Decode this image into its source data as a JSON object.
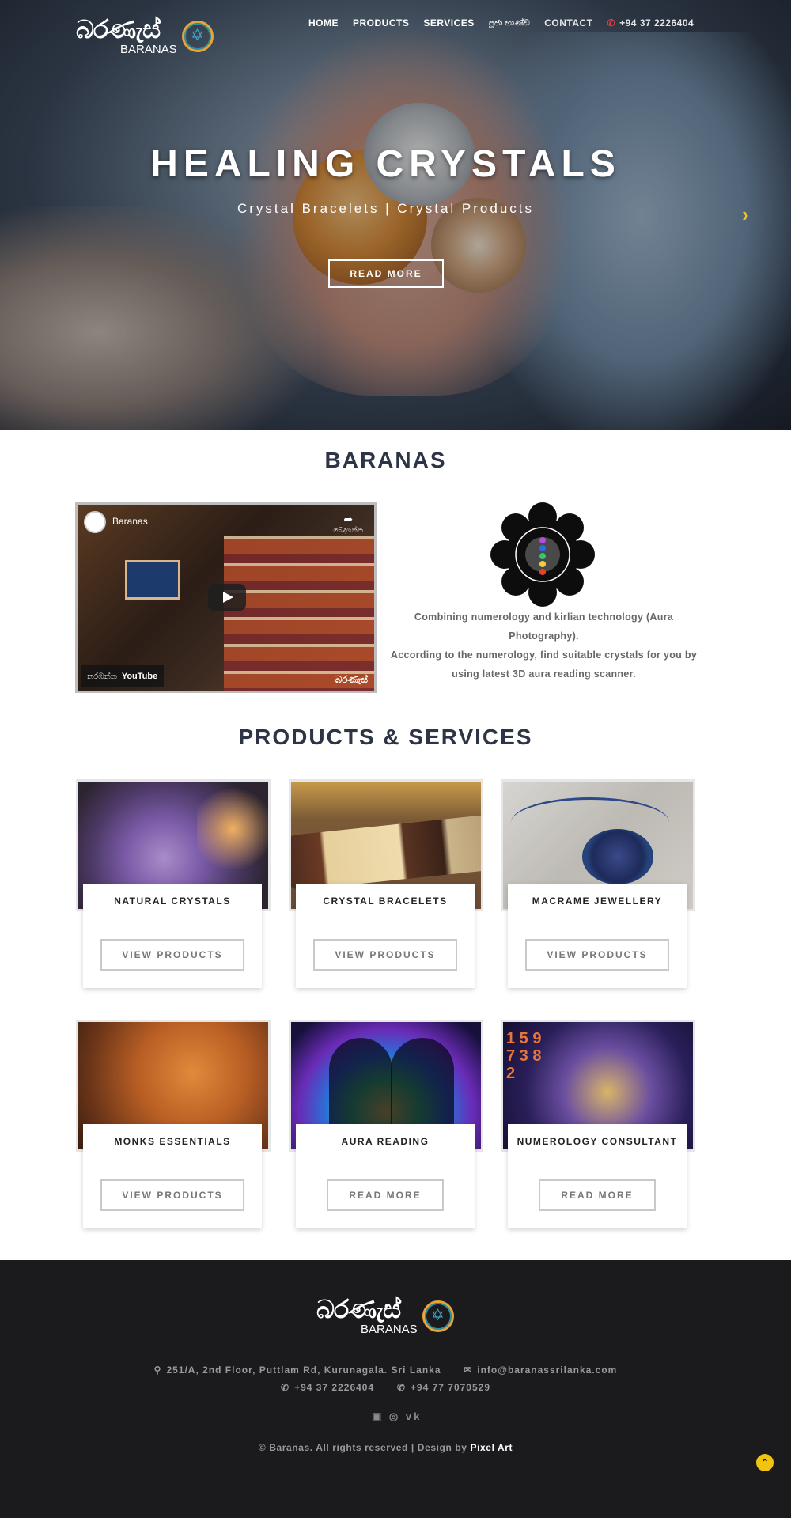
{
  "brand": {
    "script": "බරණැස්",
    "name": "BARANAS"
  },
  "nav": {
    "items": [
      "HOME",
      "PRODUCTS",
      "SERVICES",
      "පූජා භාණ්ඩ",
      "CONTACT"
    ],
    "phone": "+94 37 2226404",
    "phone_icon": "phone-icon"
  },
  "hero": {
    "title": "HEALING CRYSTALS",
    "subtitle": "Crystal Bracelets | Crystal Products",
    "button": "READ MORE",
    "next_arrow": "›"
  },
  "about": {
    "title": "BARANAS",
    "video": {
      "channel": "Baranas",
      "share_label": "බෙදාගන්න",
      "watch_on": "නරඹන්න",
      "platform": "YouTube",
      "watermark": "බරණැස්"
    },
    "paragraph_1": "Combining numerology and kirlian technology (Aura Photography).",
    "paragraph_2": "According to the numerology, find suitable crystals for you by using latest 3D aura reading scanner."
  },
  "products": {
    "title": "PRODUCTS & SERVICES",
    "cards": [
      {
        "name": "NATURAL CRYSTALS",
        "button": "VIEW PRODUCTS"
      },
      {
        "name": "CRYSTAL BRACELETS",
        "button": "VIEW PRODUCTS"
      },
      {
        "name": "MACRAME JEWELLERY",
        "button": "VIEW PRODUCTS"
      },
      {
        "name": "MONKS ESSENTIALS",
        "button": "VIEW PRODUCTS"
      },
      {
        "name": "AURA READING",
        "button": "READ MORE"
      },
      {
        "name": "NUMEROLOGY CONSULTANT",
        "button": "READ MORE"
      }
    ]
  },
  "footer": {
    "address": "251/A, 2nd Floor, Puttlam Rd, Kurunagala. Sri Lanka",
    "email": "info@baranassrilanka.com",
    "phone_1": "+94 37 2226404",
    "phone_2": "+94 77 7070529",
    "social": [
      "facebook-icon",
      "instagram-icon",
      "vk-icon"
    ],
    "copyright": "© Baranas. All rights reserved | Design by",
    "designer": "Pixel Art"
  },
  "colors": {
    "heading": "#2d3446",
    "footer_bg": "#1b1a1c",
    "accent": "#f1c40f"
  }
}
